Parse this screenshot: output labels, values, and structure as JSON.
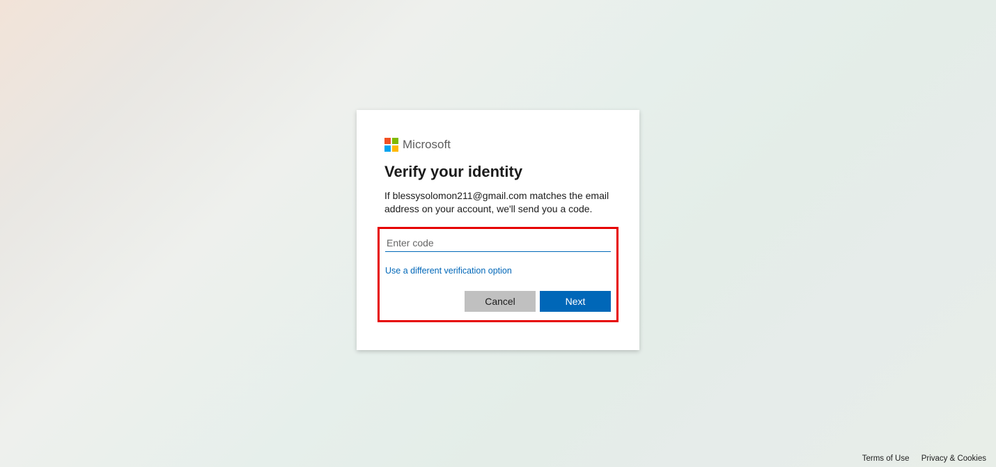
{
  "brand": {
    "name": "Microsoft"
  },
  "dialog": {
    "title": "Verify your identity",
    "description": "If blessysolomon211@gmail.com matches the email address on your account, we'll send you a code.",
    "code_placeholder": "Enter code",
    "code_value": "",
    "alt_link": "Use a different verification option",
    "cancel_label": "Cancel",
    "next_label": "Next"
  },
  "footer": {
    "terms": "Terms of Use",
    "privacy": "Privacy & Cookies"
  }
}
